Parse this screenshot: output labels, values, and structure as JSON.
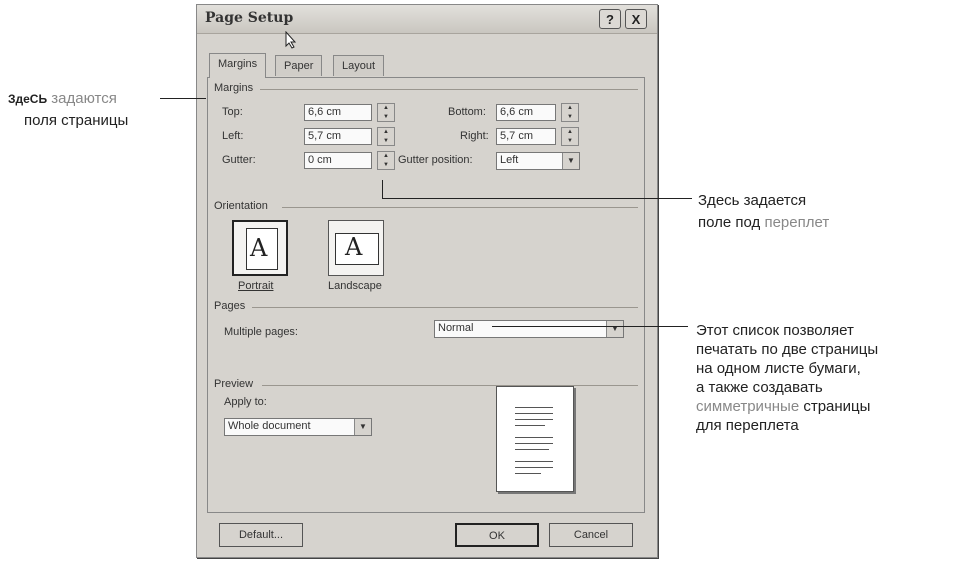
{
  "dialog": {
    "title": "Page Setup",
    "help_button": "?",
    "close_button": "X",
    "tabs": [
      "Margins",
      "Paper",
      "Layout"
    ],
    "margins": {
      "group_label": "Margins",
      "top_label": "Top:",
      "top_value": "6,6 cm",
      "bottom_label": "Bottom:",
      "bottom_value": "6,6 cm",
      "left_label": "Left:",
      "left_value": "5,7 cm",
      "right_label": "Right:",
      "right_value": "5,7 cm",
      "gutter_label": "Gutter:",
      "gutter_value": "0 cm",
      "gutter_position_label": "Gutter position:",
      "gutter_position_value": "Left"
    },
    "orientation": {
      "group_label": "Orientation",
      "portrait_label": "Portrait",
      "landscape_label": "Landscape",
      "glyph": "A"
    },
    "pages": {
      "group_label": "Pages",
      "multiple_pages_label": "Multiple pages:",
      "multiple_pages_value": "Normal"
    },
    "preview": {
      "group_label": "Preview",
      "apply_to_label": "Apply to:",
      "apply_to_value": "Whole document"
    },
    "buttons": {
      "default": "Default...",
      "ok": "OK",
      "cancel": "Cancel"
    }
  },
  "annotations": {
    "margins_note_bold": "ЗдеСЬ",
    "margins_note_hl": "задаются",
    "margins_note_line2": "поля страницы",
    "gutter_note_line1": "Здесь задается",
    "gutter_note_line2a": "поле под",
    "gutter_note_line2b": "переплет",
    "pages_note_line1": "Этот список позволяет",
    "pages_note_line2": "печатать по две страницы",
    "pages_note_line3": "на одном листе бумаги,",
    "pages_note_line4": "а также создавать",
    "pages_note_line5a": "симметричные",
    "pages_note_line5b": "страницы",
    "pages_note_line6": "для переплета"
  }
}
